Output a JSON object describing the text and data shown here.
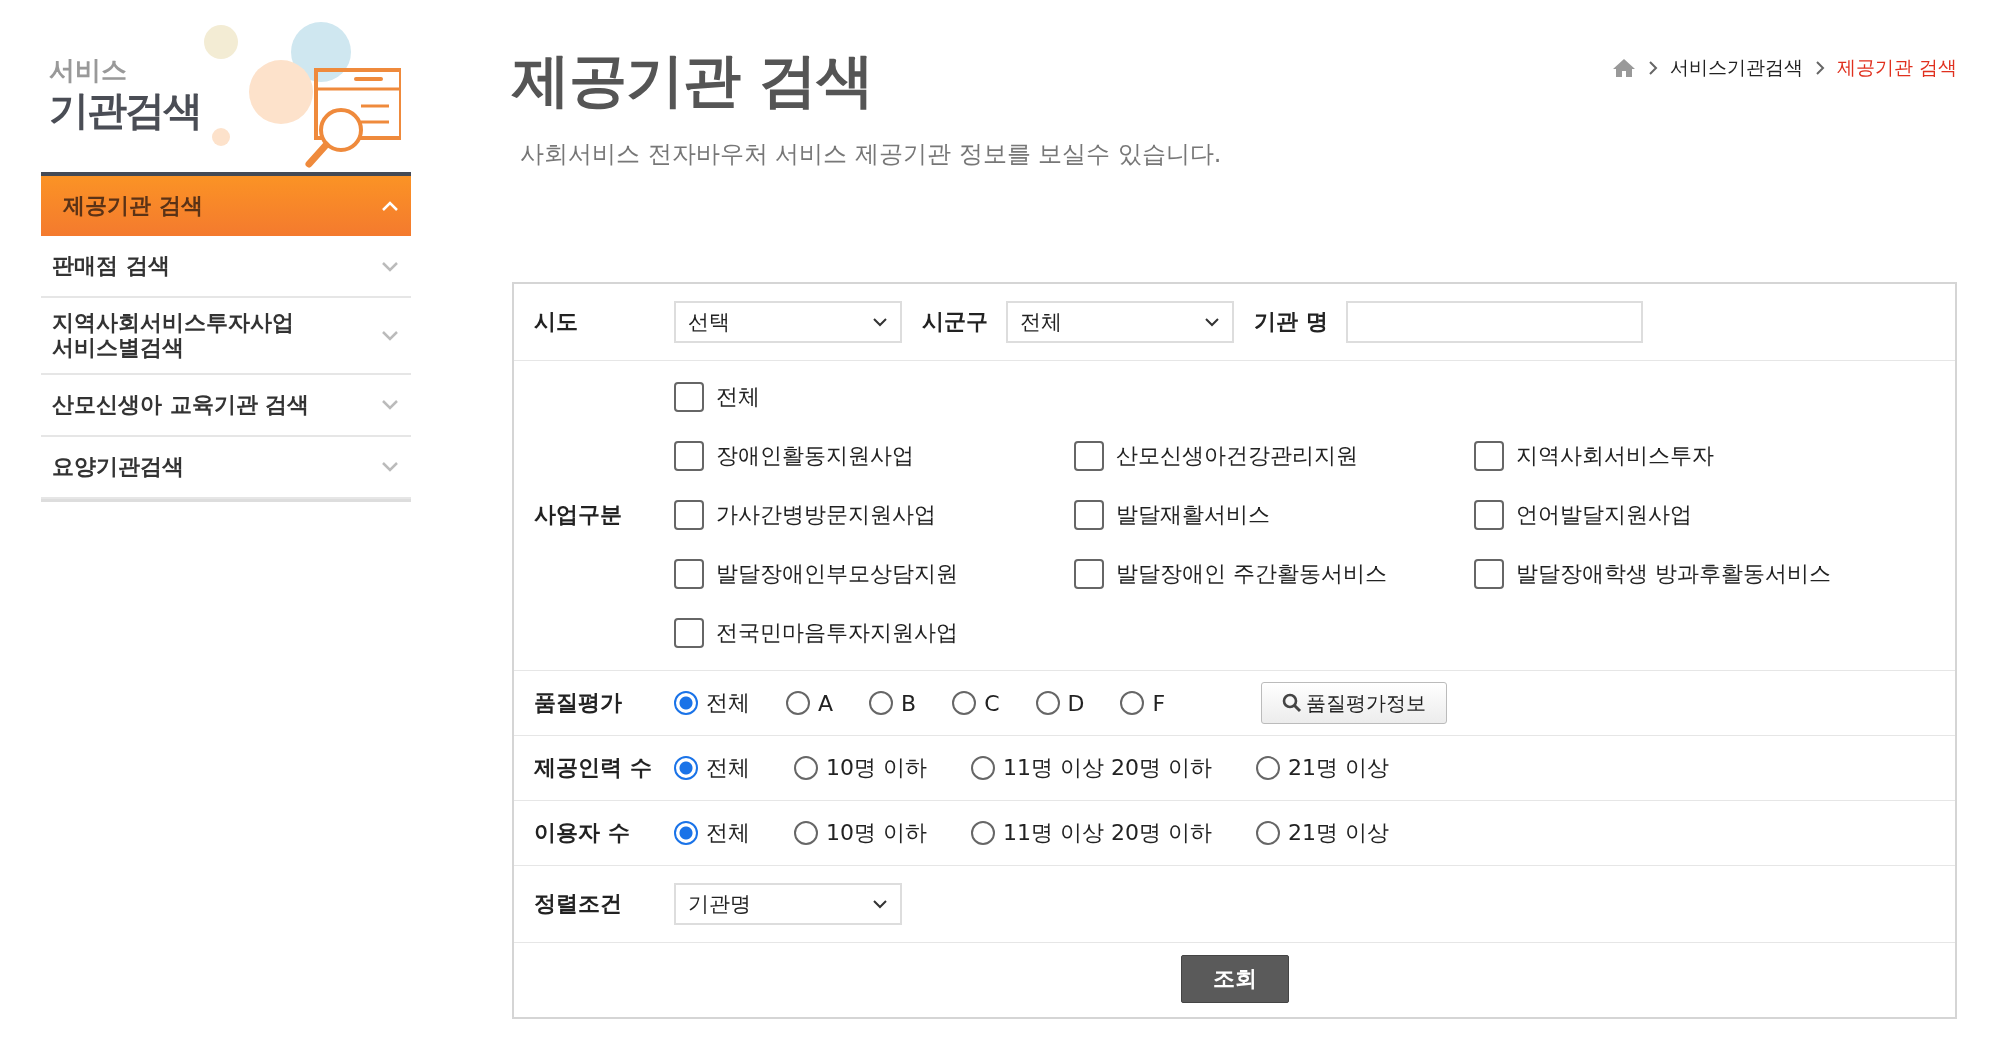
{
  "logo": {
    "small": "서비스",
    "large": "기관검색"
  },
  "sidebar": {
    "items": [
      {
        "label": "제공기관 검색",
        "selected": true,
        "expanded": true
      },
      {
        "label": "판매점 검색",
        "selected": false,
        "expanded": false
      },
      {
        "label": "지역사회서비스투자사업\n서비스별검색",
        "selected": false,
        "expanded": false
      },
      {
        "label": "산모신생아 교육기관 검색",
        "selected": false,
        "expanded": false
      },
      {
        "label": "요양기관검색",
        "selected": false,
        "expanded": false
      }
    ]
  },
  "page": {
    "title": "제공기관 검색",
    "subtitle": "사회서비스 전자바우처 서비스 제공기관 정보를 보실수 있습니다."
  },
  "breadcrumb": [
    {
      "label": "서비스기관검색",
      "current": false
    },
    {
      "label": "제공기관 검색",
      "current": true
    }
  ],
  "form": {
    "region": {
      "label": "시도",
      "value": "선택"
    },
    "district": {
      "label": "시군구",
      "value": "전체"
    },
    "agency_name": {
      "label": "기관 명"
    },
    "business_type": {
      "label": "사업구분",
      "all": {
        "label": "전체",
        "checked": false
      },
      "options": [
        {
          "label": "장애인활동지원사업",
          "checked": false
        },
        {
          "label": "산모신생아건강관리지원",
          "checked": false
        },
        {
          "label": "지역사회서비스투자",
          "checked": false
        },
        {
          "label": "가사간병방문지원사업",
          "checked": false
        },
        {
          "label": "발달재활서비스",
          "checked": false
        },
        {
          "label": "언어발달지원사업",
          "checked": false
        },
        {
          "label": "발달장애인부모상담지원",
          "checked": false
        },
        {
          "label": "발달장애인 주간활동서비스",
          "checked": false
        },
        {
          "label": "발달장애학생 방과후활동서비스",
          "checked": false
        },
        {
          "label": "전국민마음투자지원사업",
          "checked": false
        }
      ]
    },
    "radio_groups": [
      {
        "label": "품질평가",
        "options": [
          {
            "label": "전체",
            "selected": true
          },
          {
            "label": "A",
            "selected": false
          },
          {
            "label": "B",
            "selected": false
          },
          {
            "label": "C",
            "selected": false
          },
          {
            "label": "D",
            "selected": false
          },
          {
            "label": "F",
            "selected": false
          }
        ],
        "button": "품질평가정보"
      },
      {
        "label": "제공인력 수",
        "options": [
          {
            "label": "전체",
            "selected": true
          },
          {
            "label": "10명 이하",
            "selected": false
          },
          {
            "label": "11명 이상 20명 이하",
            "selected": false
          },
          {
            "label": "21명 이상",
            "selected": false
          }
        ]
      },
      {
        "label": "이용자 수",
        "options": [
          {
            "label": "전체",
            "selected": true
          },
          {
            "label": "10명 이하",
            "selected": false
          },
          {
            "label": "11명 이상 20명 이하",
            "selected": false
          },
          {
            "label": "21명 이상",
            "selected": false
          }
        ]
      }
    ],
    "sort": {
      "label": "정렬조건",
      "value": "기관명"
    },
    "submit": "조회"
  }
}
